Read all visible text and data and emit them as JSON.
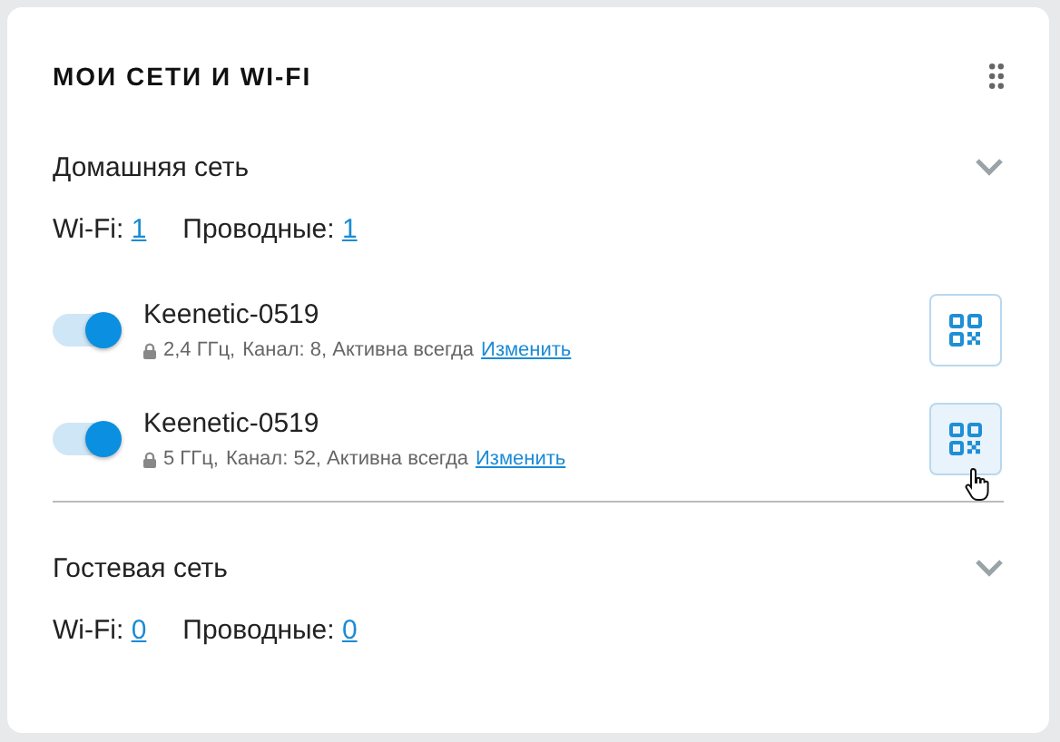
{
  "title": "МОИ СЕТИ И WI-FI",
  "sections": [
    {
      "name": "Домашняя сеть",
      "wifi_label": "Wi-Fi:",
      "wifi_count": "1",
      "wired_label": "Проводные:",
      "wired_count": "1",
      "networks": [
        {
          "name": "Keenetic-0519",
          "on": true,
          "band": "2,4 ГГц,",
          "details": "Канал: 8, Активна всегда",
          "link": "Изменить",
          "hovered": false
        },
        {
          "name": "Keenetic-0519",
          "on": true,
          "band": "5 ГГц,",
          "details": "Канал: 52, Активна всегда",
          "link": "Изменить",
          "hovered": true
        }
      ]
    },
    {
      "name": "Гостевая сеть",
      "wifi_label": "Wi-Fi:",
      "wifi_count": "0",
      "wired_label": "Проводные:",
      "wired_count": "0"
    }
  ]
}
